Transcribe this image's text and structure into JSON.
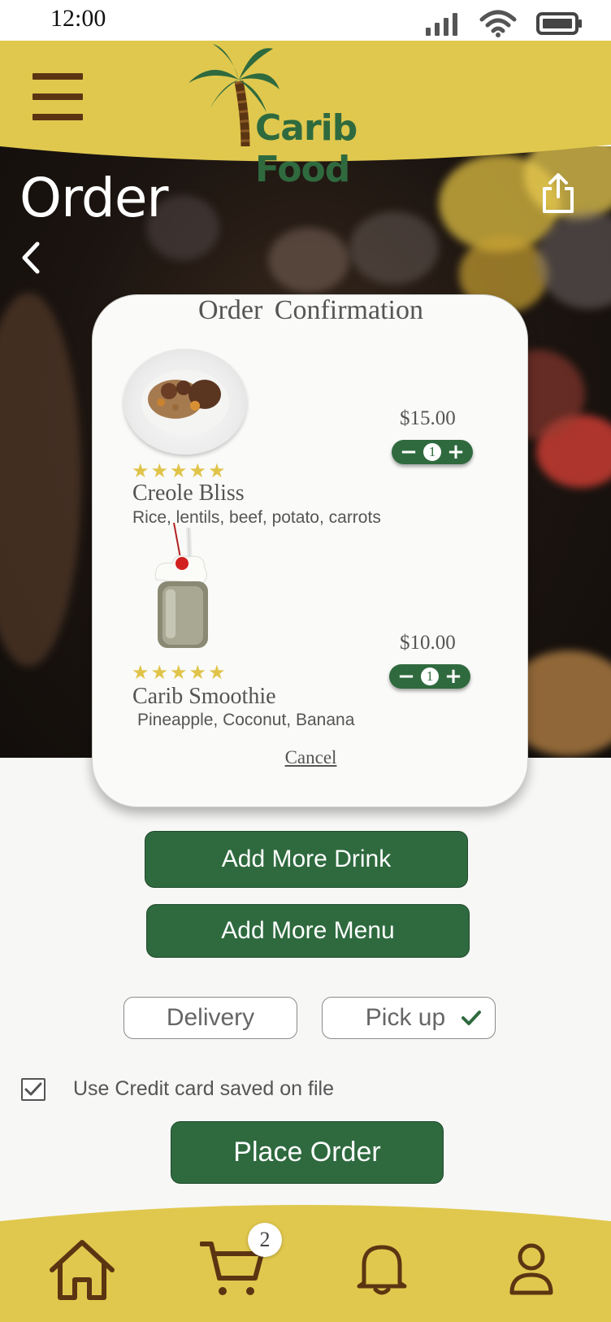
{
  "status_bar": {
    "time": "12:00"
  },
  "header": {
    "logo_text": "Carib Food"
  },
  "page": {
    "title": "Order"
  },
  "confirmation": {
    "title": "Order Confirmation",
    "items": [
      {
        "name": "Creole Bliss",
        "description": "Rice, lentils, beef, potato, carrots",
        "price": "$15.00",
        "quantity": "1",
        "rating": 5
      },
      {
        "name": "Carib Smoothie",
        "description": "Pineapple, Coconut, Banana",
        "price": "$10.00",
        "quantity": "1",
        "rating": 5
      }
    ],
    "cancel_label": "Cancel"
  },
  "actions": {
    "add_drink": "Add More Drink",
    "add_menu": "Add More Menu",
    "delivery": "Delivery",
    "pickup": "Pick up",
    "pickup_selected": true,
    "use_credit_card_label": "Use Credit card saved on file",
    "use_credit_card_checked": true,
    "place_order": "Place Order"
  },
  "bottom_nav": {
    "items": [
      "home-icon",
      "cart-icon",
      "bell-icon",
      "profile-icon"
    ],
    "cart_count": "2"
  },
  "colors": {
    "brand_yellow": "#e0c84e",
    "brand_green": "#2e6a3e",
    "brand_brown": "#5b3512"
  }
}
